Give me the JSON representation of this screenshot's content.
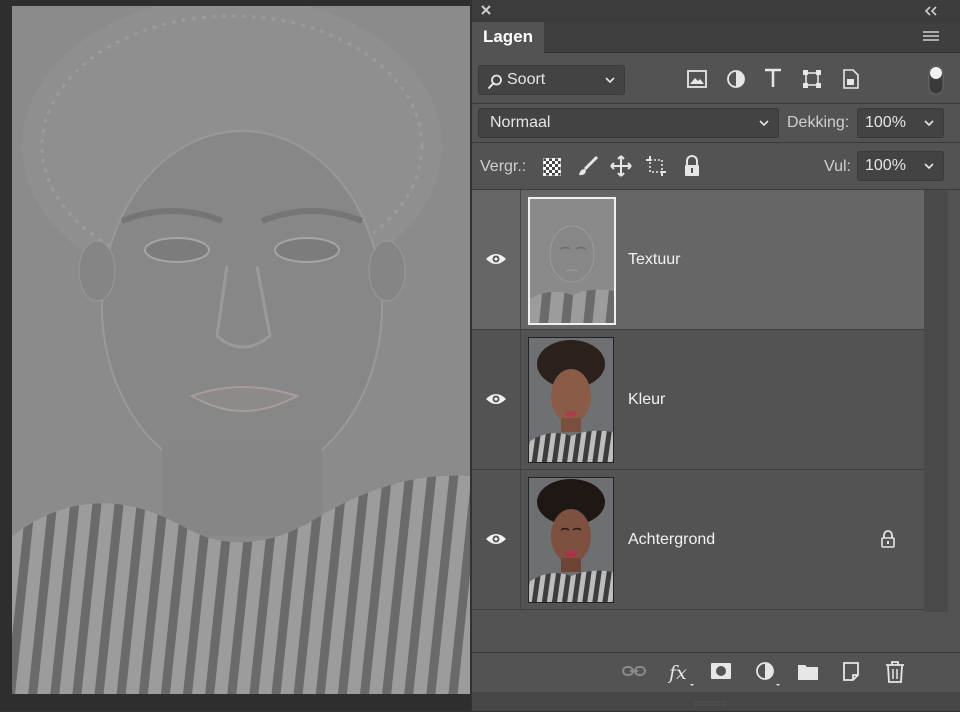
{
  "panel": {
    "tab_label": "Lagen",
    "filter": {
      "label": "Soort"
    },
    "blend_mode": "Normaal",
    "opacity": {
      "label": "Dekking:",
      "value": "100%"
    },
    "lock": {
      "label": "Vergr.:"
    },
    "fill": {
      "label": "Vul:",
      "value": "100%"
    },
    "filter_icons": [
      "image-filter-icon",
      "adjustment-filter-icon",
      "type-filter-icon",
      "shape-filter-icon",
      "smart-object-filter-icon"
    ],
    "lock_icons": [
      "lock-transparent-pixels-icon",
      "lock-image-pixels-icon",
      "lock-position-icon",
      "lock-artboard-icon",
      "lock-all-icon"
    ],
    "footer_icons": [
      "link-layers-icon",
      "fx-icon",
      "add-mask-icon",
      "adjustment-layer-icon",
      "new-group-icon",
      "new-layer-icon",
      "delete-layer-icon"
    ]
  },
  "layers": [
    {
      "name": "Textuur",
      "visible": true,
      "selected": true,
      "locked": false
    },
    {
      "name": "Kleur",
      "visible": true,
      "selected": false,
      "locked": false
    },
    {
      "name": "Achtergrond",
      "visible": true,
      "selected": false,
      "locked": true
    }
  ],
  "colors": {
    "panel_bg": "#535353",
    "selected_layer": "#666666",
    "canvas_bg": "#8a8a8a"
  }
}
